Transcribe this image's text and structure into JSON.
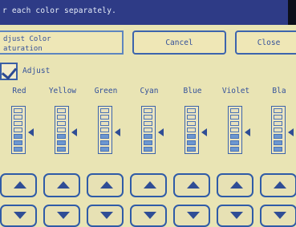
{
  "header": {
    "instruction": "r each color separately."
  },
  "panel": {
    "label_line1": "djust Color",
    "label_line2": "aturation"
  },
  "buttons": {
    "cancel": "Cancel",
    "close": "Close"
  },
  "adjust": {
    "label": "Adjust",
    "checked": true
  },
  "colors": [
    {
      "name": "Red",
      "level": 0.5
    },
    {
      "name": "Yellow",
      "level": 0.5
    },
    {
      "name": "Green",
      "level": 0.5
    },
    {
      "name": "Cyan",
      "level": 0.5
    },
    {
      "name": "Blue",
      "level": 0.5
    },
    {
      "name": "Violet",
      "level": 0.5
    },
    {
      "name": "Bla",
      "level": 0.5
    }
  ],
  "icons": {
    "increase": "triangle-up-icon",
    "decrease": "triangle-down-icon",
    "pointer": "triangle-left-icon"
  },
  "theme": {
    "accent": "#2e3b86",
    "background": "#e9e4b4",
    "control": "#3b63aa"
  }
}
